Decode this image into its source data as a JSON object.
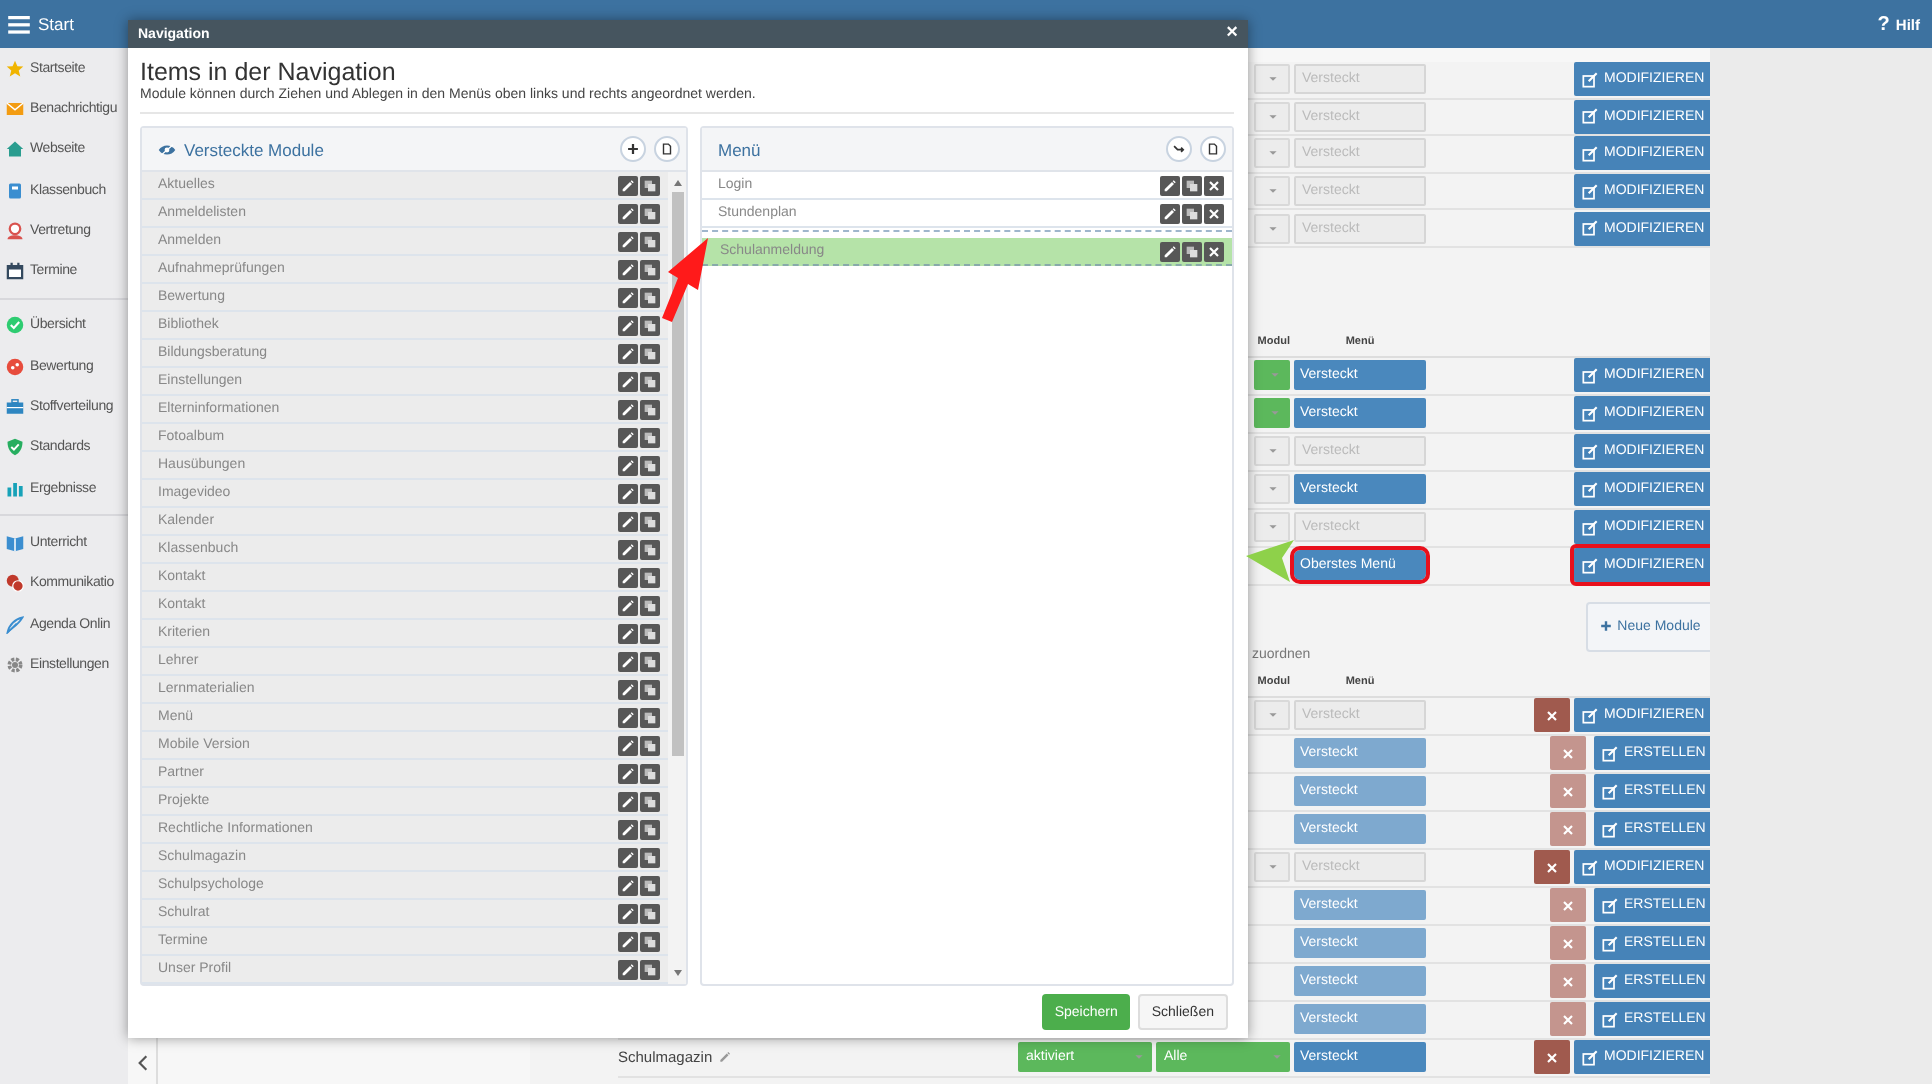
{
  "topbar": {
    "title": "Start",
    "help_icon": "?",
    "help_label": "Hilf"
  },
  "sidebar": {
    "sections": [
      {
        "items": [
          {
            "label": "Startseite"
          },
          {
            "label": "Benachrichtigu"
          },
          {
            "label": "Webseite"
          },
          {
            "label": "Klassenbuch"
          },
          {
            "label": "Vertretung"
          },
          {
            "label": "Termine"
          }
        ]
      },
      {
        "items": [
          {
            "label": "Übersicht"
          },
          {
            "label": "Bewertung"
          },
          {
            "label": "Stoffverteilung"
          },
          {
            "label": "Standards"
          },
          {
            "label": "Ergebnisse"
          }
        ]
      },
      {
        "items": [
          {
            "label": "Unterricht"
          },
          {
            "label": "Kommunikatio"
          },
          {
            "label": "Agenda Onlin"
          },
          {
            "label": "Einstellungen"
          }
        ]
      }
    ]
  },
  "background": {
    "section_1": {
      "rows": [
        {
          "dropdown": {
            "active": false
          },
          "menu": {
            "value": "Versteckt",
            "disabled": true
          },
          "action": "MODIFIZIEREN"
        },
        {
          "dropdown": {
            "active": false
          },
          "menu": {
            "value": "Versteckt",
            "disabled": true
          },
          "action": "MODIFIZIEREN"
        },
        {
          "dropdown": {
            "active": false
          },
          "menu": {
            "value": "Versteckt",
            "disabled": true
          },
          "action": "MODIFIZIEREN"
        },
        {
          "dropdown": {
            "active": false
          },
          "menu": {
            "value": "Versteckt",
            "disabled": true
          },
          "action": "MODIFIZIEREN"
        },
        {
          "dropdown": {
            "active": false
          },
          "menu": {
            "value": "Versteckt",
            "disabled": true
          },
          "action": "MODIFIZIEREN"
        }
      ]
    },
    "section_2": {
      "header": {
        "modul": "Modul",
        "menu": "Menü"
      },
      "rows": [
        {
          "dropdown": {
            "active": true
          },
          "menu": {
            "value": "Versteckt",
            "disabled": false
          },
          "action": "MODIFIZIEREN",
          "highlighted": false
        },
        {
          "dropdown": {
            "active": true
          },
          "menu": {
            "value": "Versteckt",
            "disabled": false
          },
          "action": "MODIFIZIEREN",
          "highlighted": false
        },
        {
          "dropdown": {
            "active": false
          },
          "menu": {
            "value": "Versteckt",
            "disabled": true
          },
          "action": "MODIFIZIEREN",
          "highlighted": false
        },
        {
          "dropdown": {
            "active": false
          },
          "menu": {
            "value": "Versteckt",
            "disabled": false
          },
          "action": "MODIFIZIEREN",
          "highlighted": false
        },
        {
          "dropdown": {
            "active": false
          },
          "menu": {
            "value": "Versteckt",
            "disabled": true
          },
          "action": "MODIFIZIEREN",
          "highlighted": false
        },
        {
          "menu": {
            "value": "Oberstes Menü",
            "disabled": false
          },
          "action": "MODIFIZIEREN",
          "highlighted": true
        }
      ]
    },
    "section_3": {
      "description": "zuordnen",
      "new_button": "Neue Module",
      "header": {
        "modul": "Modul",
        "menu": "Menü"
      },
      "rows": [
        {
          "kind": "existing",
          "dropdown": {
            "active": false
          },
          "menu": {
            "value": "Versteckt",
            "disabled": true
          },
          "delete": true,
          "action": "MODIFIZIEREN"
        },
        {
          "kind": "new",
          "menu": {
            "value": "Versteckt",
            "disabled": false
          },
          "delete": true,
          "action": "ERSTELLEN"
        },
        {
          "kind": "new",
          "menu": {
            "value": "Versteckt",
            "disabled": false
          },
          "delete": true,
          "action": "ERSTELLEN"
        },
        {
          "kind": "new",
          "menu": {
            "value": "Versteckt",
            "disabled": false
          },
          "delete": true,
          "action": "ERSTELLEN"
        },
        {
          "kind": "existing",
          "dropdown": {
            "active": false
          },
          "menu": {
            "value": "Versteckt",
            "disabled": true
          },
          "delete": true,
          "action": "MODIFIZIEREN"
        },
        {
          "kind": "new",
          "menu": {
            "value": "Versteckt",
            "disabled": false
          },
          "delete": true,
          "action": "ERSTELLEN"
        },
        {
          "kind": "new",
          "menu": {
            "value": "Versteckt",
            "disabled": false
          },
          "delete": true,
          "action": "ERSTELLEN"
        },
        {
          "kind": "new",
          "menu": {
            "value": "Versteckt",
            "disabled": false
          },
          "delete": true,
          "action": "ERSTELLEN"
        },
        {
          "kind": "new",
          "menu": {
            "value": "Versteckt",
            "disabled": false
          },
          "delete": true,
          "action": "ERSTELLEN"
        },
        {
          "kind": "existing",
          "name": "Schulmagazin",
          "status": {
            "value": "aktiviert",
            "active": true
          },
          "dropdown": {
            "value": "Alle",
            "active": true
          },
          "menu": {
            "value": "Versteckt",
            "disabled": false
          },
          "delete": true,
          "action": "MODIFIZIEREN"
        }
      ]
    }
  },
  "modal": {
    "title": "Navigation",
    "close": "×",
    "heading": "Items in der Navigation",
    "description": "Module können durch Ziehen und Ablegen in den Menüs oben links und rechts angeordnet werden.",
    "hidden_panel": {
      "title": "Versteckte Module",
      "items": [
        {
          "label": "Aktuelles"
        },
        {
          "label": "Anmeldelisten"
        },
        {
          "label": "Anmelden"
        },
        {
          "label": "Aufnahmeprüfungen"
        },
        {
          "label": "Bewertung"
        },
        {
          "label": "Bibliothek"
        },
        {
          "label": "Bildungsberatung"
        },
        {
          "label": "Einstellungen"
        },
        {
          "label": "Elterninformationen"
        },
        {
          "label": "Fotoalbum"
        },
        {
          "label": "Hausübungen"
        },
        {
          "label": "Imagevideo"
        },
        {
          "label": "Kalender"
        },
        {
          "label": "Klassenbuch"
        },
        {
          "label": "Kontakt"
        },
        {
          "label": "Kontakt"
        },
        {
          "label": "Kriterien"
        },
        {
          "label": "Lehrer"
        },
        {
          "label": "Lernmaterialien"
        },
        {
          "label": "Menü"
        },
        {
          "label": "Mobile Version"
        },
        {
          "label": "Partner"
        },
        {
          "label": "Projekte"
        },
        {
          "label": "Rechtliche Informationen"
        },
        {
          "label": "Schulmagazin"
        },
        {
          "label": "Schulpsychologe"
        },
        {
          "label": "Schulrat"
        },
        {
          "label": "Termine"
        },
        {
          "label": "Unser Profil"
        }
      ]
    },
    "menu_panel": {
      "title": "Menü",
      "items": [
        {
          "label": "Login",
          "dragging": false
        },
        {
          "label": "Stundenplan",
          "dragging": false
        },
        {
          "label": "Schulanmeldung",
          "dragging": true
        }
      ]
    },
    "buttons": [
      {
        "label": "Speichern",
        "primary": true
      },
      {
        "label": "Schließen",
        "primary": false
      }
    ]
  }
}
